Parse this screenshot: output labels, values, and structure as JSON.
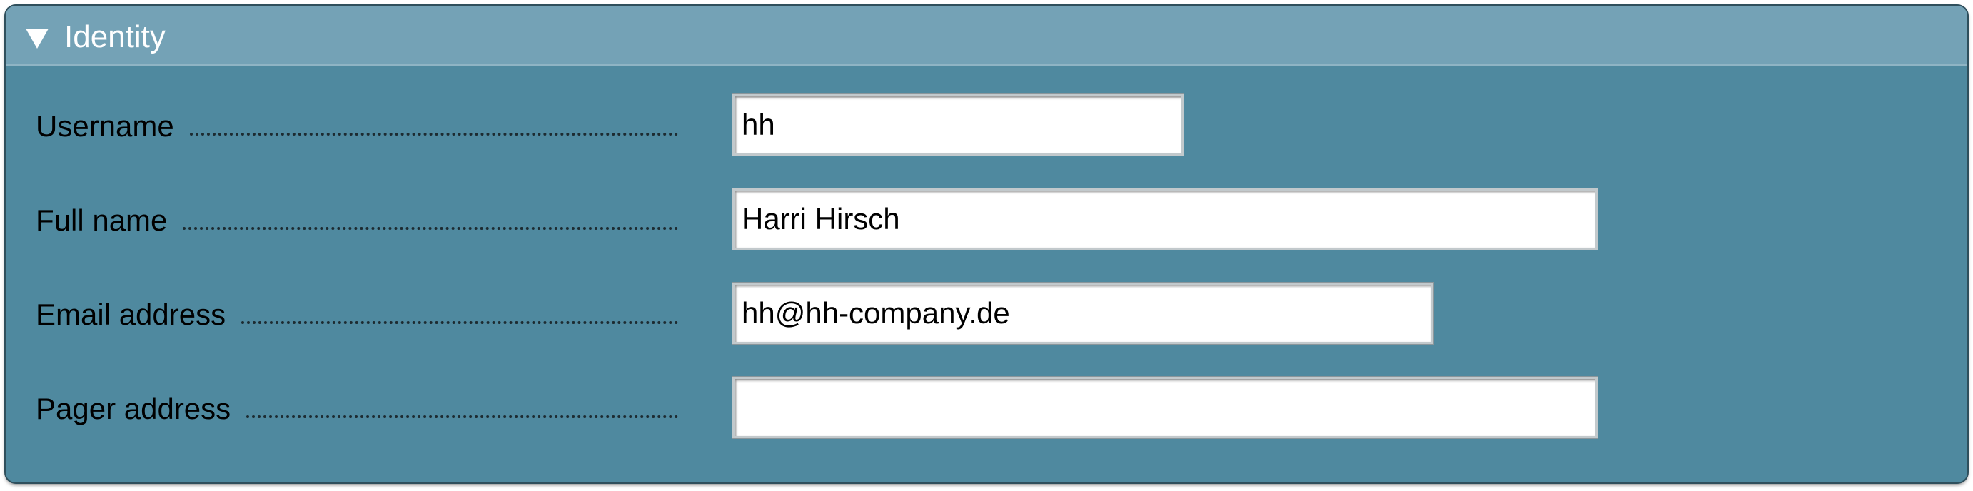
{
  "section": {
    "title": "Identity",
    "toggle_icon": "triangle-down-icon"
  },
  "fields": {
    "username": {
      "label": "Username",
      "value": "hh",
      "placeholder": ""
    },
    "full_name": {
      "label": "Full name",
      "value": "Harri Hirsch",
      "placeholder": ""
    },
    "email": {
      "label": "Email address",
      "value": "hh@hh-company.de",
      "placeholder": ""
    },
    "pager": {
      "label": "Pager address",
      "value": "",
      "placeholder": ""
    }
  },
  "colors": {
    "panel_background": "#4f899f",
    "header_background": "#74a2b6",
    "header_text": "#ffffff"
  }
}
